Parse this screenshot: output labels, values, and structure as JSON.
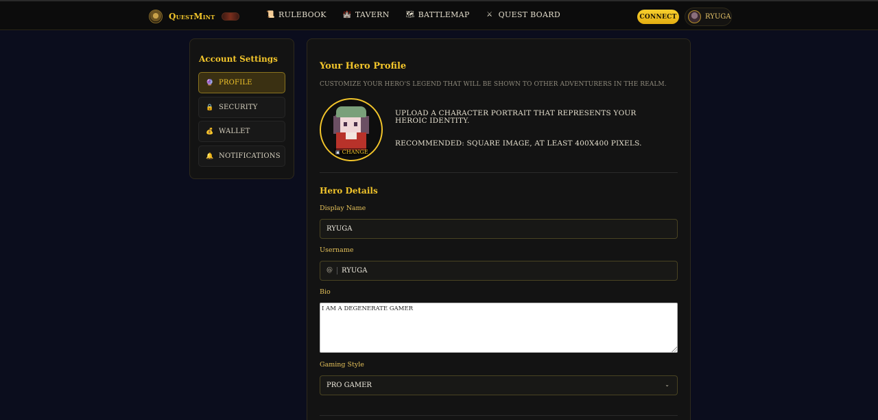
{
  "nav": {
    "brand": "QuestMint",
    "links": [
      {
        "label": "RULEBOOK",
        "icon": "scroll-icon",
        "glyph": "📜"
      },
      {
        "label": "TAVERN",
        "icon": "castle-icon",
        "glyph": "🏰"
      },
      {
        "label": "BATTLEMAP",
        "icon": "map-icon",
        "glyph": "🗺"
      },
      {
        "label": "QUEST BOARD",
        "icon": "crossed-swords-icon",
        "glyph": "⚔"
      }
    ],
    "connect_label": "CONNECT",
    "user_name": "RYUGA"
  },
  "sidebar": {
    "title": "Account Settings",
    "items": [
      {
        "label": "PROFILE",
        "icon": "crystal-ball-icon",
        "glyph": "🔮",
        "active": true
      },
      {
        "label": "SECURITY",
        "icon": "lock-icon",
        "glyph": "🔒",
        "active": false
      },
      {
        "label": "WALLET",
        "icon": "money-bag-icon",
        "glyph": "💰",
        "active": false
      },
      {
        "label": "NOTIFICATIONS",
        "icon": "bell-icon",
        "glyph": "🔔",
        "active": false
      }
    ]
  },
  "profile": {
    "title": "Your Hero Profile",
    "subtitle": "CUSTOMIZE YOUR HERO'S LEGEND THAT WILL BE SHOWN TO OTHER ADVENTURERS IN THE REALM.",
    "change_label": "CHANGE",
    "upload_text": "UPLOAD A CHARACTER PORTRAIT THAT REPRESENTS YOUR HEROIC IDENTITY.",
    "recommend_text": "RECOMMENDED: SQUARE IMAGE, AT LEAST 400X400 PIXELS."
  },
  "details": {
    "title": "Hero Details",
    "display_name_label": "Display Name",
    "display_name_value": "RYUGA",
    "username_label": "Username",
    "username_prefix": "@",
    "username_value": "RYUGA",
    "bio_label": "Bio",
    "bio_value": "I AM A DEGENERATE GAMER",
    "gaming_style_label": "Gaming Style",
    "gaming_style_value": "PRO GAMER"
  },
  "colors": {
    "accent": "#f2c52b",
    "background": "#0b0d1d",
    "card": "#131313"
  }
}
